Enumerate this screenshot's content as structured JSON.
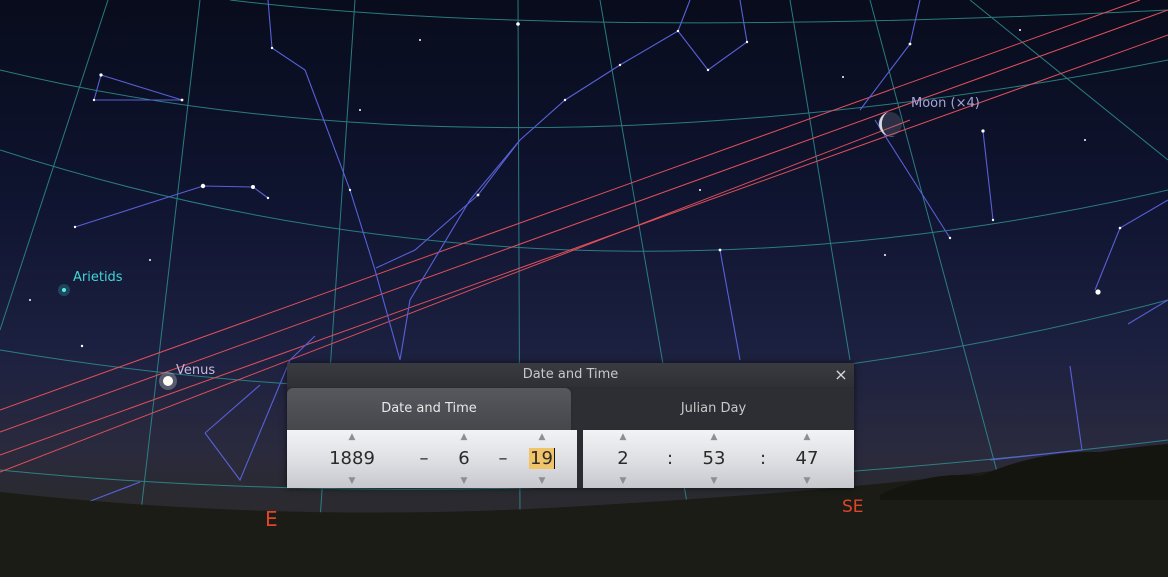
{
  "sky": {
    "labels": {
      "arietids": "Arietids",
      "venus": "Venus",
      "moon": "Moon (×4)"
    },
    "cardinals": {
      "east": "E",
      "southeast": "SE"
    }
  },
  "dialog": {
    "title": "Date and Time",
    "close_icon": "×",
    "tabs": {
      "datetime": "Date and Time",
      "julian": "Julian Day"
    },
    "date": {
      "year": "1889",
      "month": "6",
      "day": "19",
      "separator": "–"
    },
    "time": {
      "hour": "2",
      "minute": "53",
      "second": "47",
      "separator": ":"
    },
    "arrow_up": "▲",
    "arrow_down": "▼"
  },
  "colors": {
    "ecliptic": "#e0505a",
    "grid": "#2f8f8f",
    "constellation": "#5860d8",
    "cardinal": "#e0452a",
    "meteor_label": "#3fd6d6",
    "selection": "#f2c46a"
  }
}
